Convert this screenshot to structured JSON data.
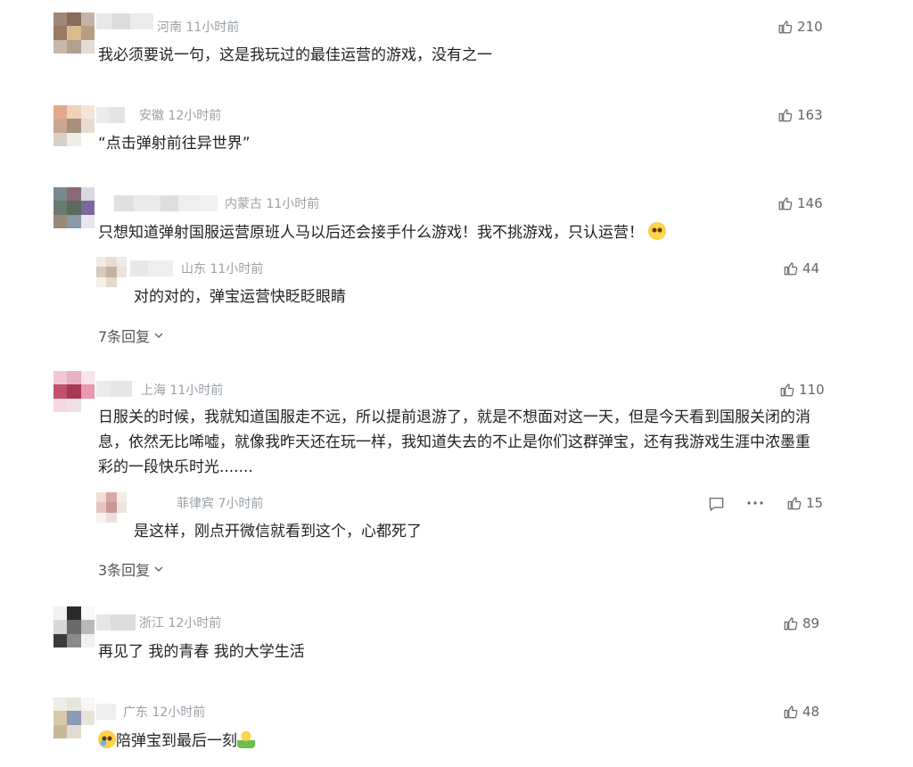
{
  "comments": [
    {
      "location": "河南",
      "time": "11小时前",
      "text": "我必须要说一句，这是我玩过的最佳运营的游戏，没有之一",
      "likes": "210"
    },
    {
      "location": "安徽",
      "time": "12小时前",
      "text": "“点击弹射前往异世界”",
      "likes": "163"
    },
    {
      "location": "内蒙古",
      "time": "11小时前",
      "text": "只想知道弹射国服运营原班人马以后还会接手什么游戏！我不挑游戏，只认运营！",
      "emoji": "pleading-face-emoji",
      "likes": "146",
      "reply": {
        "location": "山东",
        "time": "11小时前",
        "text": "对的对的，弹宝运营快眨眨眼睛",
        "likes": "44"
      },
      "more_replies": "7条回复"
    },
    {
      "location": "上海",
      "time": "11小时前",
      "text": "日服关的时候，我就知道国服走不远，所以提前退游了，就是不想面对这一天，但是今天看到国服关闭的消息，依然无比唏嘘，就像我昨天还在玩一样，我知道失去的不止是你们这群弹宝，还有我游戏生涯中浓墨重彩的一段快乐时光.......",
      "likes": "110",
      "reply": {
        "location": "菲律宾",
        "time": "7小时前",
        "text": "是这样，刚点开微信就看到这个，心都死了",
        "likes": "15"
      },
      "more_replies": "3条回复"
    },
    {
      "location": "浙江",
      "time": "12小时前",
      "text": "再见了 我的青春 我的大学生活",
      "likes": "89"
    },
    {
      "location": "广东",
      "time": "12小时前",
      "text": "陪弹宝到最后一刻",
      "emoji_before": "crying-face-emoji",
      "emoji_after": "shrugging-person-emoji",
      "likes": "48"
    }
  ],
  "colors": {
    "meta": "#9aa0a6",
    "text": "#222222",
    "like": "#666666"
  }
}
